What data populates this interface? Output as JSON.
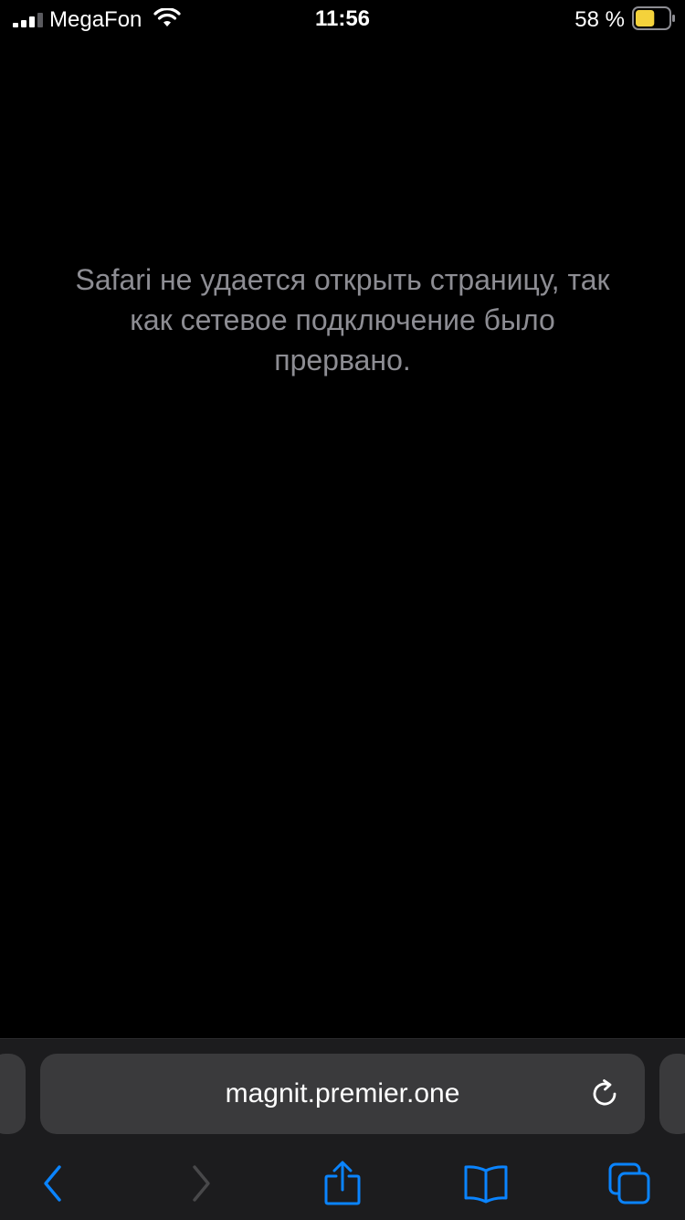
{
  "status_bar": {
    "carrier": "MegaFon",
    "time": "11:56",
    "battery_percent_text": "58 %",
    "battery_level": 0.58,
    "battery_color": "#f4d23b"
  },
  "error": {
    "message": "Safari не удается открыть страницу, так как сетевое подключение было прервано."
  },
  "address_bar": {
    "url": "magnit.premier.one",
    "reload_icon": "reload-icon"
  },
  "toolbar": {
    "items": [
      {
        "icon": "back-chevron-icon",
        "enabled": true
      },
      {
        "icon": "forward-chevron-icon",
        "enabled": false
      },
      {
        "icon": "share-icon",
        "enabled": true
      },
      {
        "icon": "bookmarks-icon",
        "enabled": true
      },
      {
        "icon": "tabs-icon",
        "enabled": true
      }
    ],
    "accent_color": "#0a84ff",
    "disabled_color": "#48484a"
  }
}
